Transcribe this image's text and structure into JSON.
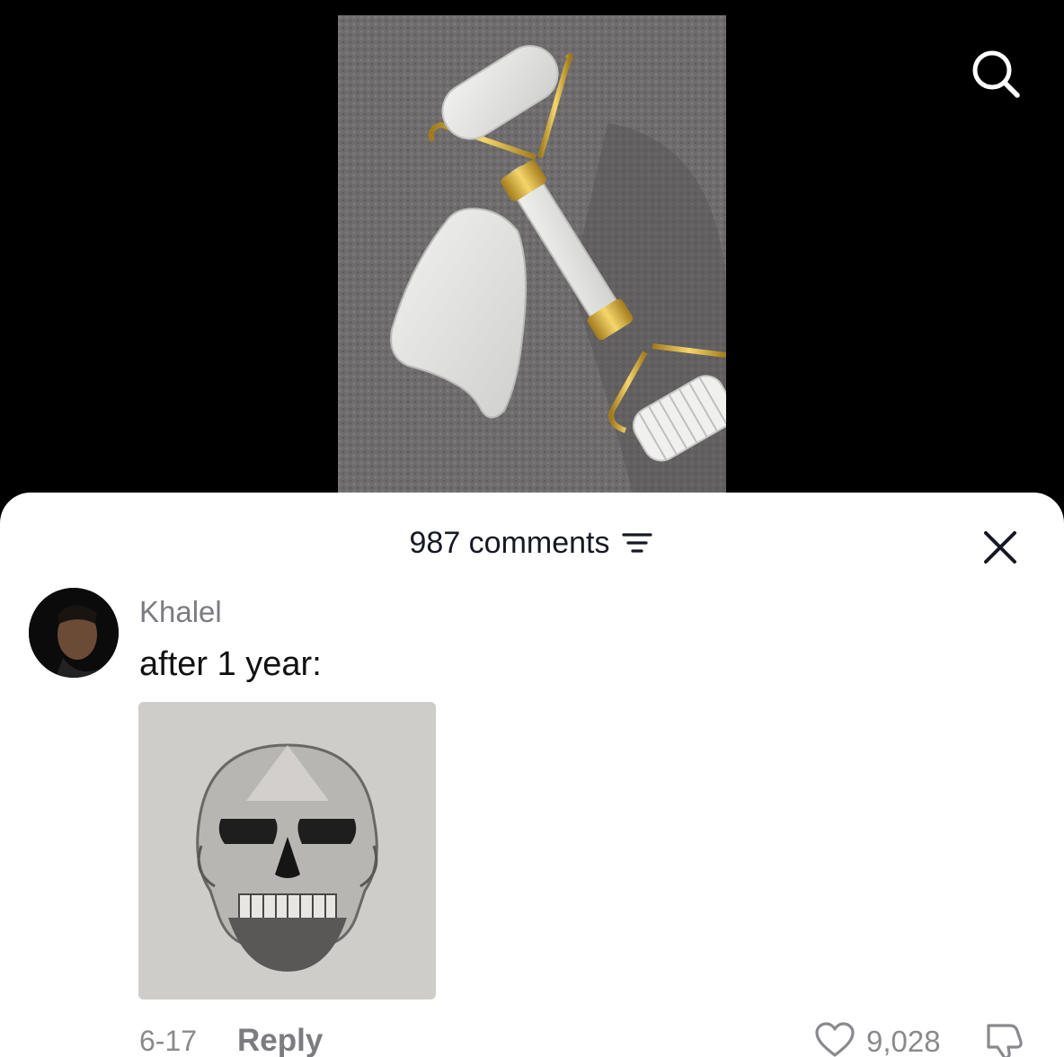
{
  "header": {
    "search_icon": "search-icon"
  },
  "sheet": {
    "comments_count": "987 comments",
    "filter_icon": "filter-icon",
    "close_icon": "close-icon"
  },
  "comment": {
    "username": "Khalel",
    "text": "after 1 year:",
    "date": "6-17",
    "reply_label": "Reply",
    "like_count": "9,028",
    "like_icon": "heart-icon",
    "dislike_icon": "thumbs-down-icon"
  },
  "colors": {
    "sheet_background": "#ffffff",
    "primary_text": "#161823",
    "secondary_text": "#8a8a8e",
    "background": "#000000"
  }
}
